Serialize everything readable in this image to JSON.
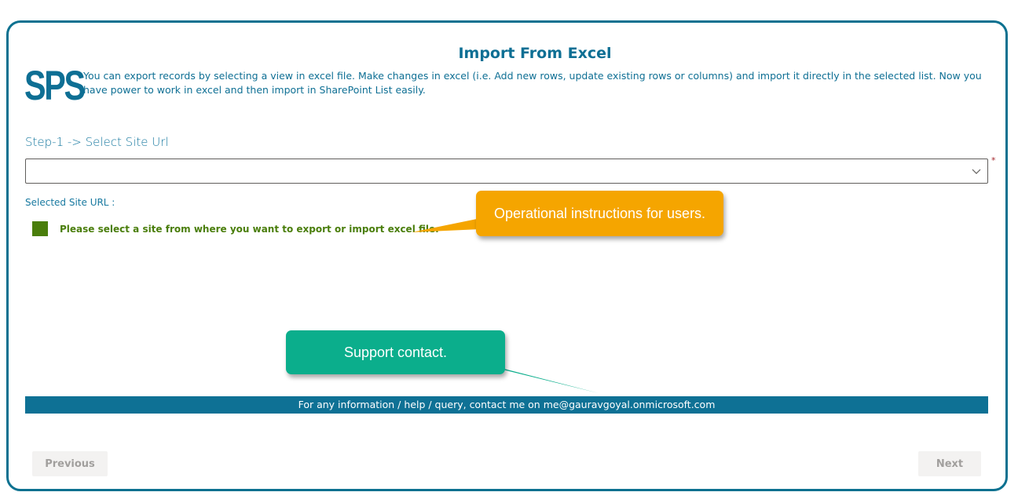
{
  "header": {
    "title": "Import From Excel",
    "logo_text": "SPS",
    "intro": "You can export records by selecting a view in excel file. Make changes in excel (i.e. Add new rows, update existing rows or columns) and import it directly in the selected list. Now you have power to work in excel and then import in SharePoint List easily."
  },
  "step1": {
    "label": "Step-1 -> Select Site Url",
    "dropdown_value": "",
    "required_marker": "*"
  },
  "selected_site": {
    "label": "Selected Site URL :",
    "message": "Please select a site from where you want to export or import excel file."
  },
  "callouts": {
    "operational": "Operational instructions for users.",
    "support": "Support contact."
  },
  "footer": {
    "text": "For any information / help / query, contact me on me@gauravgoyal.onmicrosoft.com"
  },
  "buttons": {
    "previous": "Previous",
    "next": "Next"
  },
  "icons": {
    "dropdown": "chevron-down-icon"
  },
  "colors": {
    "accent": "#0e6f94",
    "frame_border": "#0c7190",
    "status_green": "#4a7e0c",
    "callout_orange": "#f5a500",
    "callout_teal": "#0bae8c",
    "footer_bar": "#0e7195",
    "required": "#a4262c"
  }
}
